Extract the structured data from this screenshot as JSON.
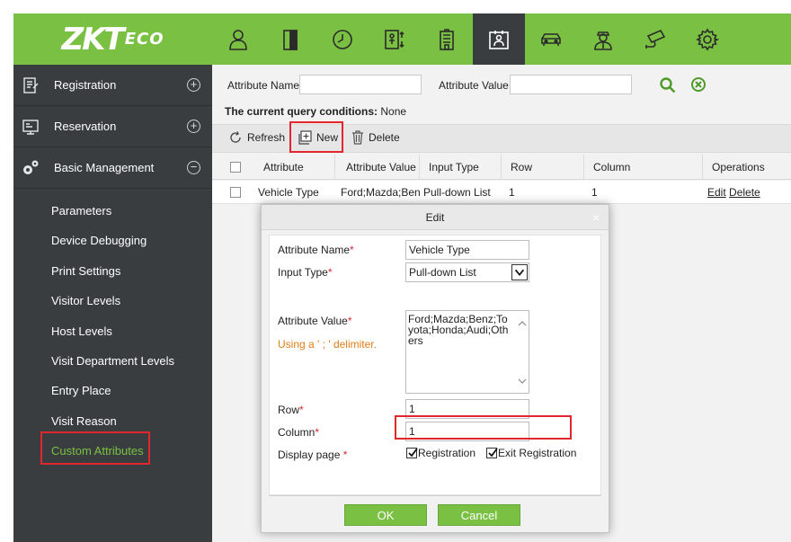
{
  "logo": {
    "main": "ZKT",
    "suffix": "ECO"
  },
  "modules": [
    {
      "icon": "personnel-icon"
    },
    {
      "icon": "access-door-icon"
    },
    {
      "icon": "attendance-clock-icon"
    },
    {
      "icon": "elevator-icon"
    },
    {
      "icon": "building-icon"
    },
    {
      "icon": "visitor-icon",
      "active": true
    },
    {
      "icon": "parking-car-icon"
    },
    {
      "icon": "patrol-guard-icon"
    },
    {
      "icon": "video-camera-icon"
    },
    {
      "icon": "system-gear-icon"
    }
  ],
  "sidebar": {
    "sections": [
      {
        "label": "Registration",
        "toggle": "+"
      },
      {
        "label": "Reservation",
        "toggle": "+"
      },
      {
        "label": "Basic Management",
        "toggle": "−"
      }
    ],
    "items": [
      {
        "label": "Parameters"
      },
      {
        "label": "Device Debugging"
      },
      {
        "label": "Print Settings"
      },
      {
        "label": "Visitor Levels"
      },
      {
        "label": "Host Levels"
      },
      {
        "label": "Visit Department Levels"
      },
      {
        "label": "Entry Place"
      },
      {
        "label": "Visit Reason"
      },
      {
        "label": "Custom Attributes",
        "active": true
      }
    ]
  },
  "filter": {
    "attr_name_label": "Attribute Name",
    "attr_name_value": "",
    "attr_value_label": "Attribute Value",
    "attr_value_value": ""
  },
  "conditions": {
    "label": "The current query conditions:",
    "value": "None"
  },
  "toolbar": {
    "refresh": "Refresh",
    "new": "New",
    "delete": "Delete"
  },
  "table": {
    "columns": [
      "Attribute Name",
      "Attribute Value",
      "Input Type",
      "Row",
      "Column",
      "Operations"
    ],
    "rows": [
      {
        "attribute_name": "Vehicle Type",
        "attribute_value": "Ford;Mazda;Benz",
        "input_type": "Pull-down List",
        "row": "1",
        "column": "1",
        "edit": "Edit",
        "delete": "Delete"
      }
    ]
  },
  "dialog": {
    "title": "Edit",
    "close": "×",
    "fields": {
      "attr_name_label": "Attribute Name",
      "attr_name_value": "Vehicle Type",
      "input_type_label": "Input Type",
      "input_type_value": "Pull-down List",
      "attr_value_label": "Attribute Value",
      "attr_value_hint": "Using a ' ; ' delimiter.",
      "attr_value_value": "Ford;Mazda;Benz;Toyota;Honda;Audi;Others",
      "row_label": "Row",
      "row_value": "1",
      "column_label": "Column",
      "column_value": "1",
      "display_page_label": "Display page",
      "opt_registration": "Registration",
      "opt_registration_checked": true,
      "opt_exit_registration": "Exit Registration",
      "opt_exit_registration_checked": true
    },
    "ok": "OK",
    "cancel": "Cancel"
  },
  "colors": {
    "accent": "#7ac143",
    "sidebar": "#3a3d3f",
    "highlight": "#e2262d",
    "hint": "#e07d18"
  }
}
